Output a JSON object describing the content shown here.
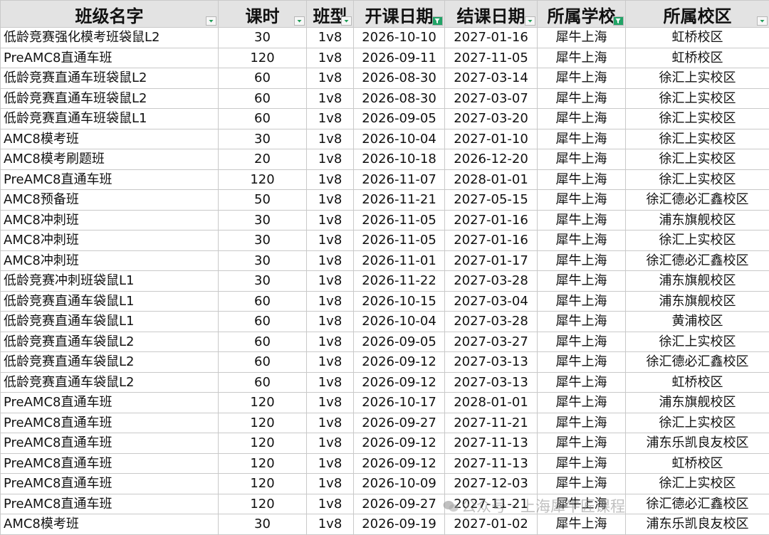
{
  "columns": [
    {
      "label": "班级名字",
      "filter": "dropdown-arrow-icon"
    },
    {
      "label": "课时",
      "filter": "dropdown-arrow-icon"
    },
    {
      "label": "班型",
      "filter": "dropdown-arrow-icon"
    },
    {
      "label": "开课日期",
      "filter": "filter-active-icon"
    },
    {
      "label": "结课日期",
      "filter": "dropdown-arrow-icon"
    },
    {
      "label": "所属学校",
      "filter": "filter-active-icon"
    },
    {
      "label": "所属校区",
      "filter": "dropdown-arrow-icon"
    }
  ],
  "rows": [
    [
      "低龄竞赛强化模考班袋鼠L2",
      "30",
      "1v8",
      "2026-10-10",
      "2027-01-16",
      "犀牛上海",
      "虹桥校区"
    ],
    [
      "PreAMC8直通车班",
      "120",
      "1v8",
      "2026-09-11",
      "2027-11-05",
      "犀牛上海",
      "虹桥校区"
    ],
    [
      "低龄竞赛直通车班袋鼠L2",
      "60",
      "1v8",
      "2026-08-30",
      "2027-03-14",
      "犀牛上海",
      "徐汇上实校区"
    ],
    [
      "低龄竞赛直通车班袋鼠L2",
      "60",
      "1v8",
      "2026-08-30",
      "2027-03-07",
      "犀牛上海",
      "徐汇上实校区"
    ],
    [
      "低龄竞赛直通车班袋鼠L1",
      "60",
      "1v8",
      "2026-09-05",
      "2027-03-20",
      "犀牛上海",
      "徐汇上实校区"
    ],
    [
      "AMC8模考班",
      "30",
      "1v8",
      "2026-10-04",
      "2027-01-10",
      "犀牛上海",
      "徐汇上实校区"
    ],
    [
      "AMC8模考刷题班",
      "20",
      "1v8",
      "2026-10-18",
      "2026-12-20",
      "犀牛上海",
      "徐汇上实校区"
    ],
    [
      "PreAMC8直通车班",
      "120",
      "1v8",
      "2026-11-07",
      "2028-01-01",
      "犀牛上海",
      "徐汇上实校区"
    ],
    [
      "AMC8预备班",
      "50",
      "1v8",
      "2026-11-21",
      "2027-05-15",
      "犀牛上海",
      "徐汇德必汇鑫校区"
    ],
    [
      "AMC8冲刺班",
      "30",
      "1v8",
      "2026-11-05",
      "2027-01-16",
      "犀牛上海",
      "浦东旗舰校区"
    ],
    [
      "AMC8冲刺班",
      "30",
      "1v8",
      "2026-11-05",
      "2027-01-16",
      "犀牛上海",
      "徐汇上实校区"
    ],
    [
      "AMC8冲刺班",
      "30",
      "1v8",
      "2026-11-01",
      "2027-01-17",
      "犀牛上海",
      "徐汇德必汇鑫校区"
    ],
    [
      "低龄竞赛冲刺班袋鼠L1",
      "30",
      "1v8",
      "2026-11-22",
      "2027-03-28",
      "犀牛上海",
      "浦东旗舰校区"
    ],
    [
      "低龄竞赛直通车袋鼠L1",
      "60",
      "1v8",
      "2026-10-15",
      "2027-03-04",
      "犀牛上海",
      "浦东旗舰校区"
    ],
    [
      "低龄竞赛直通车袋鼠L1",
      "60",
      "1v8",
      "2026-10-04",
      "2027-03-28",
      "犀牛上海",
      "黄浦校区"
    ],
    [
      "低龄竞赛直通车袋鼠L2",
      "60",
      "1v8",
      "2026-09-05",
      "2027-03-27",
      "犀牛上海",
      "徐汇上实校区"
    ],
    [
      "低龄竞赛直通车袋鼠L2",
      "60",
      "1v8",
      "2026-09-12",
      "2027-03-13",
      "犀牛上海",
      "徐汇德必汇鑫校区"
    ],
    [
      "低龄竞赛直通车袋鼠L2",
      "60",
      "1v8",
      "2026-09-12",
      "2027-03-13",
      "犀牛上海",
      "虹桥校区"
    ],
    [
      "PreAMC8直通车班",
      "120",
      "1v8",
      "2026-10-17",
      "2028-01-01",
      "犀牛上海",
      "浦东旗舰校区"
    ],
    [
      "PreAMC8直通车班",
      "120",
      "1v8",
      "2026-09-27",
      "2027-11-21",
      "犀牛上海",
      "徐汇上实校区"
    ],
    [
      "PreAMC8直通车班",
      "120",
      "1v8",
      "2026-09-12",
      "2027-11-13",
      "犀牛上海",
      "浦东乐凯良友校区"
    ],
    [
      "PreAMC8直通车班",
      "120",
      "1v8",
      "2026-09-12",
      "2027-11-13",
      "犀牛上海",
      "虹桥校区"
    ],
    [
      "PreAMC8直通车班",
      "120",
      "1v8",
      "2026-10-09",
      "2027-12-03",
      "犀牛上海",
      "徐汇上实校区"
    ],
    [
      "PreAMC8直通车班",
      "120",
      "1v8",
      "2026-09-27",
      "2027-11-21",
      "犀牛上海",
      "徐汇德必汇鑫校区"
    ],
    [
      "AMC8模考班",
      "30",
      "1v8",
      "2026-09-19",
      "2027-01-02",
      "犀牛上海",
      "浦东乐凯良友校区"
    ]
  ],
  "watermark": {
    "text": "公众号 · 上海犀牛匠课程",
    "icon": "wechat-icon"
  },
  "colors": {
    "header_bg": "#e3e3e3",
    "filter_active": "#21a366",
    "filter_arrow": "#1f9d57",
    "grid": "#c9c9c9"
  }
}
